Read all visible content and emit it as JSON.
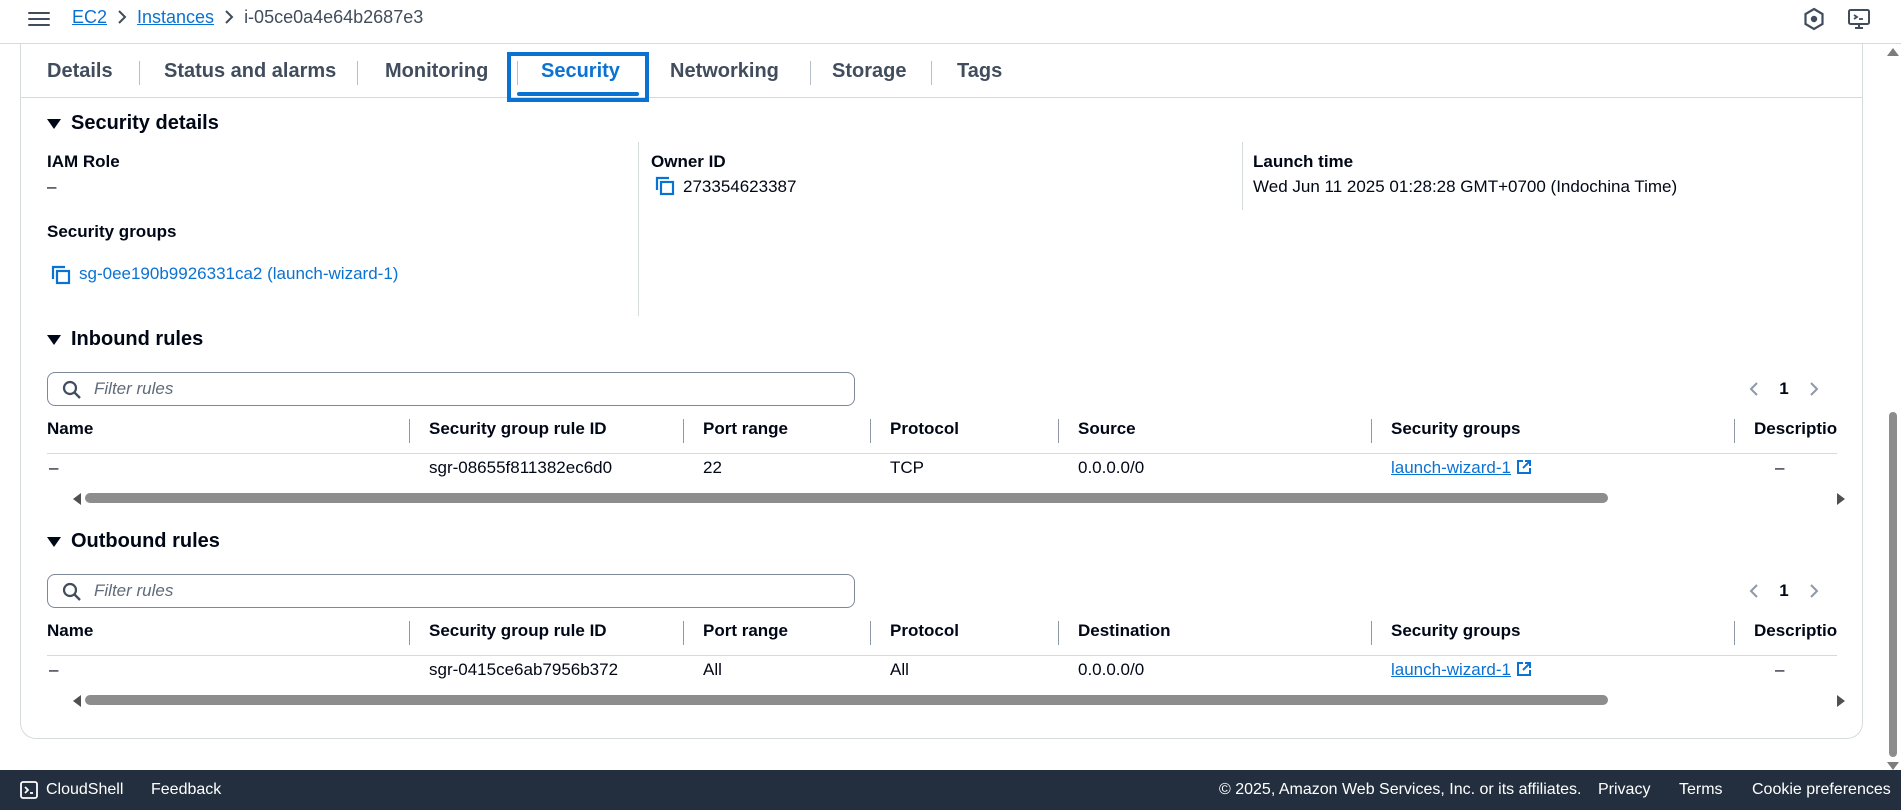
{
  "breadcrumb": {
    "items": [
      "EC2",
      "Instances"
    ],
    "current": "i-05ce0a4e64b2687e3"
  },
  "tabs": [
    "Details",
    "Status and alarms",
    "Monitoring",
    "Security",
    "Networking",
    "Storage",
    "Tags"
  ],
  "active_tab": "Security",
  "security_details": {
    "title": "Security details",
    "iam_role_label": "IAM Role",
    "iam_role_value": "–",
    "owner_id_label": "Owner ID",
    "owner_id_value": "273354623387",
    "launch_time_label": "Launch time",
    "launch_time_value": "Wed Jun 11 2025 01:28:28 GMT+0700 (Indochina Time)",
    "security_groups_label": "Security groups",
    "security_group_link": "sg-0ee190b9926331ca2 (launch-wizard-1)"
  },
  "inbound": {
    "title": "Inbound rules",
    "filter_placeholder": "Filter rules",
    "page": "1",
    "columns": [
      "Name",
      "Security group rule ID",
      "Port range",
      "Protocol",
      "Source",
      "Security groups",
      "Descriptio"
    ],
    "rows": [
      {
        "name": "–",
        "rule_id": "sgr-08655f811382ec6d0",
        "port_range": "22",
        "protocol": "TCP",
        "source": "0.0.0.0/0",
        "security_group": "launch-wizard-1",
        "description": "–"
      }
    ]
  },
  "outbound": {
    "title": "Outbound rules",
    "filter_placeholder": "Filter rules",
    "page": "1",
    "columns": [
      "Name",
      "Security group rule ID",
      "Port range",
      "Protocol",
      "Destination",
      "Security groups",
      "Descriptio"
    ],
    "rows": [
      {
        "name": "–",
        "rule_id": "sgr-0415ce6ab7956b372",
        "port_range": "All",
        "protocol": "All",
        "destination": "0.0.0.0/0",
        "security_group": "launch-wizard-1",
        "description": "–"
      }
    ]
  },
  "footer": {
    "cloudshell": "CloudShell",
    "feedback": "Feedback",
    "copyright": "© 2025, Amazon Web Services, Inc. or its affiliates.",
    "privacy": "Privacy",
    "terms": "Terms",
    "cookie": "Cookie preferences"
  },
  "icons": {
    "menu": "hamburger-icon",
    "breadcrumb_sep": "chevron-right-icon",
    "notifications": "hexagon-icon",
    "display": "display-settings-icon",
    "copy": "copy-icon",
    "search": "search-icon",
    "external": "external-link-icon",
    "cloudshell": "terminal-icon"
  },
  "colors": {
    "accent": "#0972d3",
    "text": "#000716",
    "footer_bg": "#232f3e"
  }
}
